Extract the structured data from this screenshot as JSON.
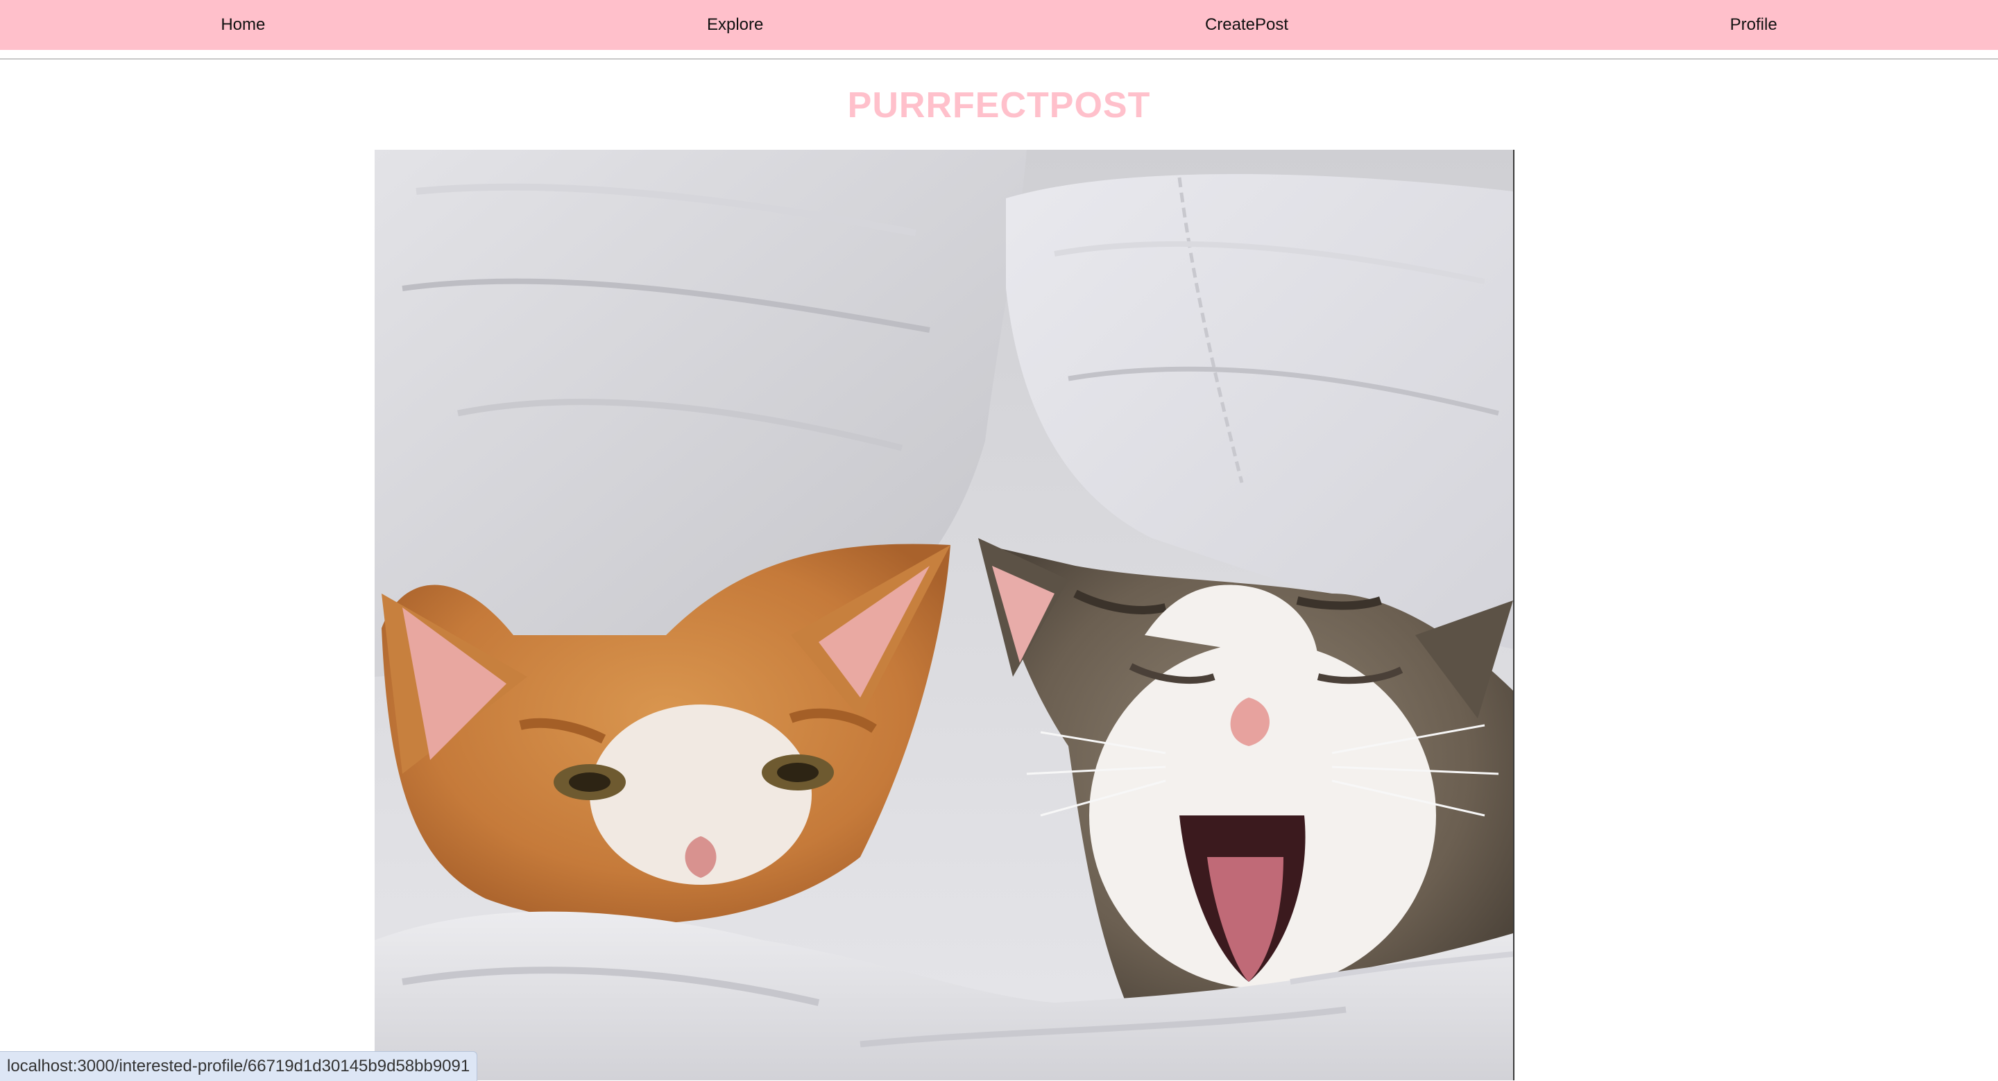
{
  "nav": {
    "items": [
      {
        "label": "Home"
      },
      {
        "label": "Explore"
      },
      {
        "label": "CreatePost"
      },
      {
        "label": "Profile"
      }
    ]
  },
  "brand": {
    "title": "PURRFECTPOST"
  },
  "post": {
    "image_icon": "cat-photo"
  },
  "status_bar": {
    "url": "localhost:3000/interested-profile/66719d1d30145b9d58bb9091"
  },
  "colors": {
    "nav_background": "#ffc0cb",
    "brand": "#ffc0cb",
    "status_background": "#dde6f5"
  }
}
